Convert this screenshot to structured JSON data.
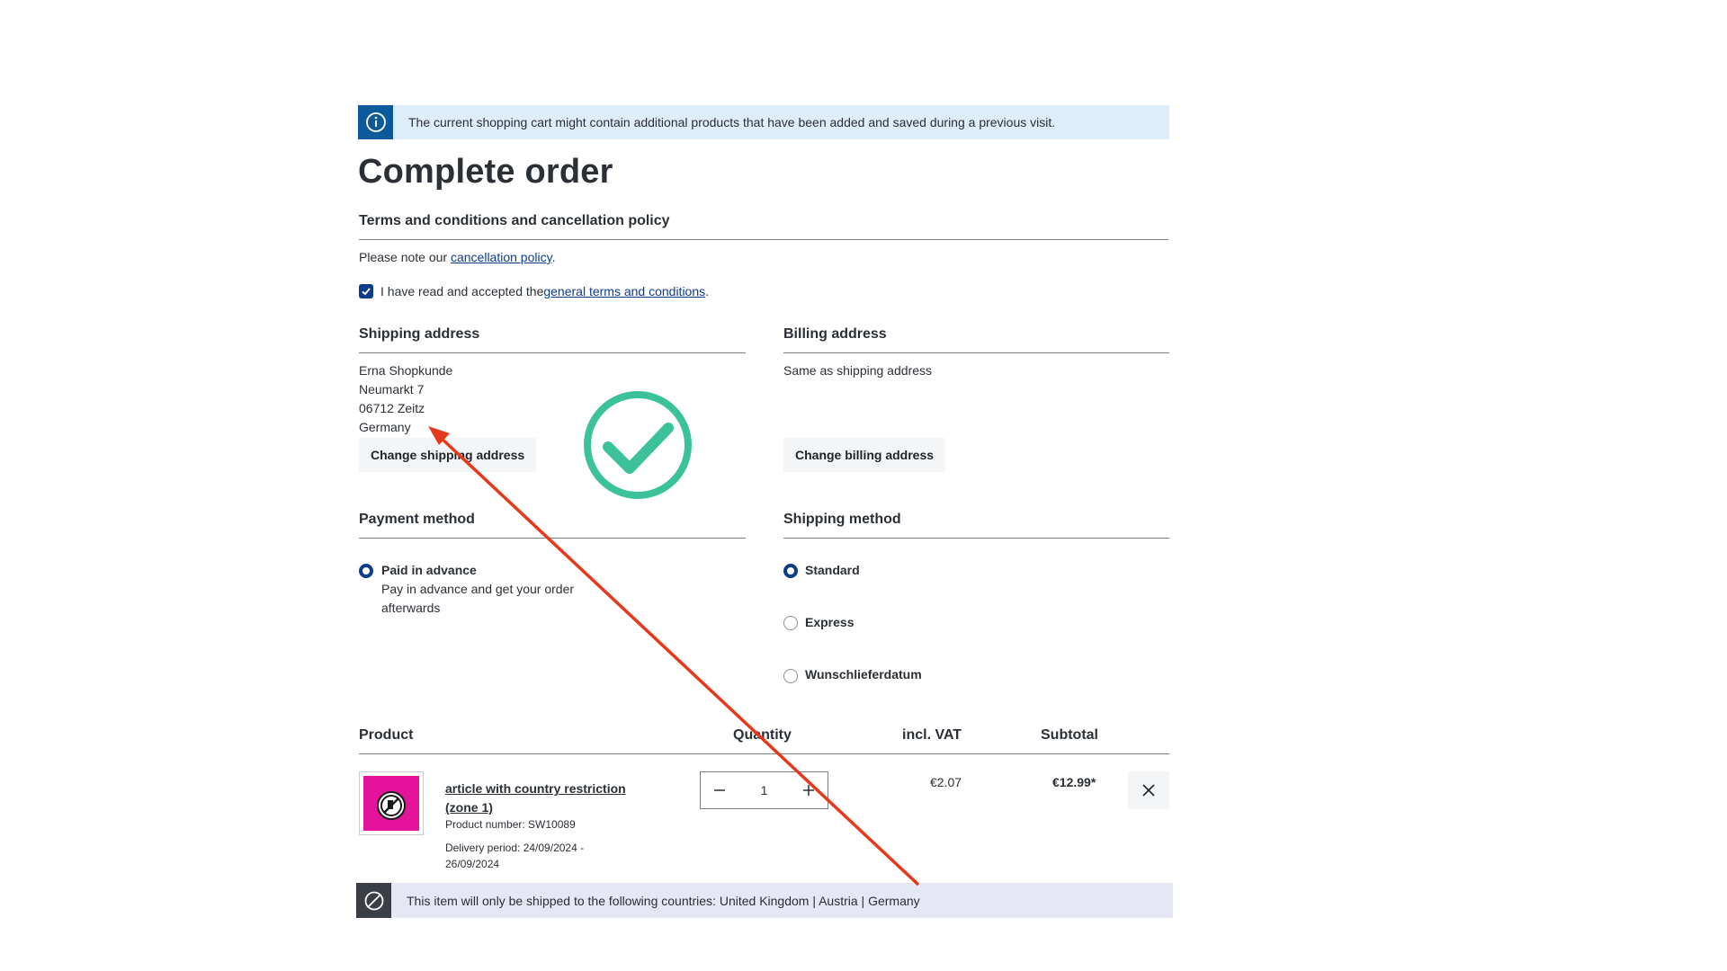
{
  "info_alert": {
    "text": "The current shopping cart might contain additional products that have been added and saved during a previous visit.",
    "icon": "info-icon"
  },
  "page": {
    "title": "Complete order"
  },
  "terms": {
    "heading": "Terms and conditions and cancellation policy",
    "note_prefix": "Please note our ",
    "note_link": "cancellation policy",
    "note_suffix": ".",
    "accept_prefix": "I have read and accepted the ",
    "accept_link": "general terms and conditions",
    "accept_suffix": ".",
    "accepted": true
  },
  "shipping_address": {
    "heading": "Shipping address",
    "lines": [
      "Erna Shopkunde",
      "Neumarkt 7",
      "06712 Zeitz",
      "Germany"
    ],
    "change_button": "Change shipping address"
  },
  "billing_address": {
    "heading": "Billing address",
    "text": "Same as shipping address",
    "change_button": "Change billing address"
  },
  "payment_method": {
    "heading": "Payment method",
    "options": [
      {
        "label": "Paid in advance",
        "description": "Pay in advance and get your order afterwards",
        "selected": true
      }
    ]
  },
  "shipping_method": {
    "heading": "Shipping method",
    "options": [
      {
        "label": "Standard",
        "selected": true
      },
      {
        "label": "Express",
        "selected": false
      },
      {
        "label": "Wunschlieferdatum",
        "selected": false
      }
    ]
  },
  "cart_table": {
    "headers": {
      "product": "Product",
      "quantity": "Quantity",
      "vat": "incl. VAT",
      "subtotal": "Subtotal"
    },
    "items": [
      {
        "name": "article with country restriction (zone 1)",
        "product_number": "Product number: SW10089",
        "delivery_period": "Delivery period: 24/09/2024 - 26/09/2024",
        "quantity": "1",
        "vat": "€2.07",
        "subtotal": "€12.99*"
      }
    ]
  },
  "restriction_alert": {
    "text": "This item will only be shipped to the following countries: United Kingdom | Austria | Germany",
    "icon": "blocked-icon"
  },
  "colors": {
    "primary": "#0d3c8c",
    "info_bg": "#ddedf9",
    "info_icon_bg": "#0d5a9a",
    "annotation_red": "#e8381b",
    "check_green": "#3cc29a",
    "thumb_magenta": "#e3149b"
  }
}
